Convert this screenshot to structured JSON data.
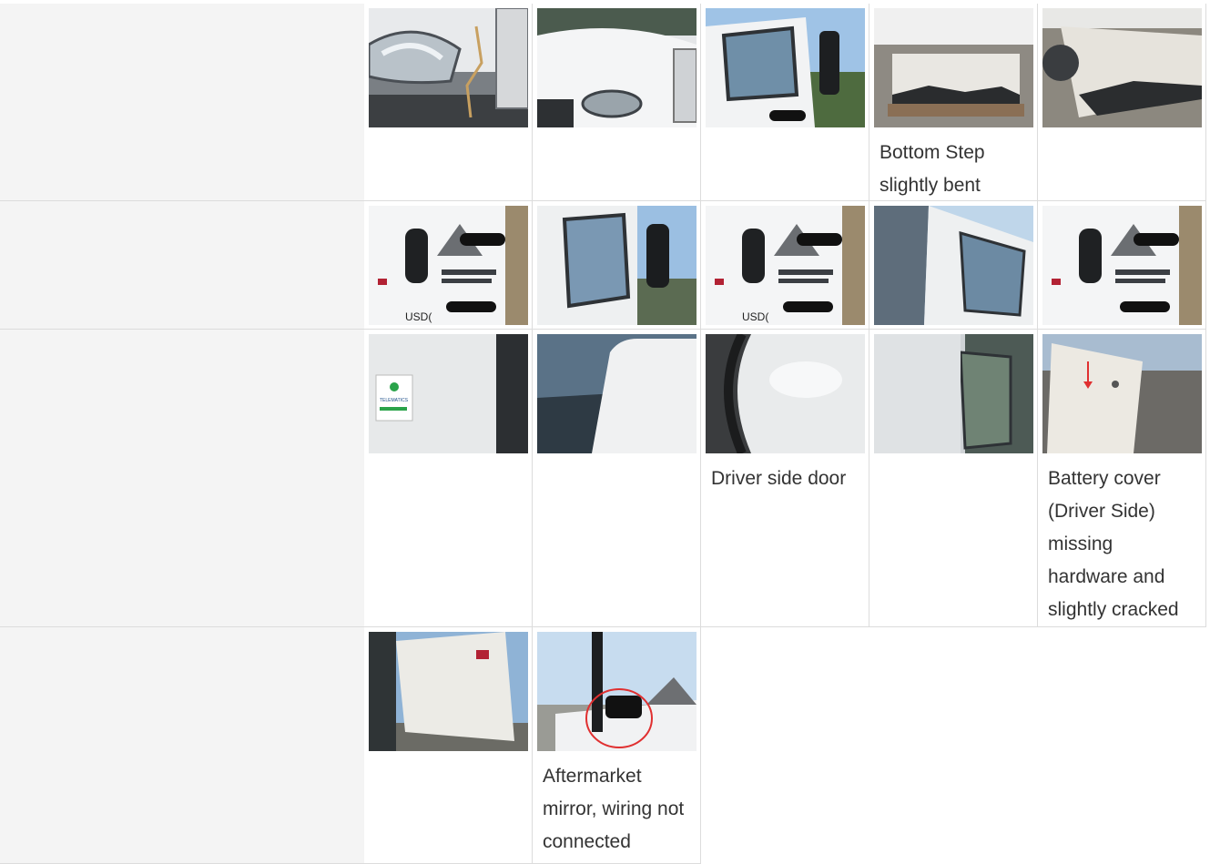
{
  "rows": [
    {
      "photos": [
        {
          "icon": "headlight-crack-photo",
          "caption": "",
          "scene": "headlight"
        },
        {
          "icon": "front-hood-photo",
          "caption": "",
          "scene": "hood"
        },
        {
          "icon": "cab-window-photo",
          "caption": "",
          "scene": "cabwindow"
        },
        {
          "icon": "bottom-step-photo",
          "caption": "Bottom Step slightly bent",
          "scene": "step"
        },
        {
          "icon": "step-closeup-photo",
          "caption": "",
          "scene": "step2"
        }
      ]
    },
    {
      "photos": [
        {
          "icon": "door-logo-photo",
          "caption": "",
          "scene": "door",
          "door_text": "USD("
        },
        {
          "icon": "mirror-window-photo",
          "caption": "",
          "scene": "mirror"
        },
        {
          "icon": "door-flag-photo",
          "caption": "",
          "scene": "door2",
          "door_text": "USD("
        },
        {
          "icon": "cab-side-photo",
          "caption": "",
          "scene": "cabside"
        },
        {
          "icon": "door-handle-photo",
          "caption": "",
          "scene": "door3"
        }
      ]
    },
    {
      "photos": [
        {
          "icon": "telematics-sticker-photo",
          "caption": "",
          "scene": "telematics",
          "sticker_text": "TELEMATICS"
        },
        {
          "icon": "cab-corner-photo",
          "caption": "",
          "scene": "corner"
        },
        {
          "icon": "driver-door-photo",
          "caption": "Driver side door",
          "scene": "seal"
        },
        {
          "icon": "panel-reflection-photo",
          "caption": "",
          "scene": "panel"
        },
        {
          "icon": "battery-cover-photo",
          "caption": "Battery cover (Driver Side) missing hardware and slightly cracked",
          "scene": "battery"
        }
      ]
    },
    {
      "photos": [
        {
          "icon": "rear-cab-photo",
          "caption": "",
          "scene": "rearcab"
        },
        {
          "icon": "aftermarket-mirror-photo",
          "caption": "Aftermarket mirror, wiring not connected",
          "scene": "mirror2"
        }
      ]
    }
  ],
  "colors": {
    "label_bg": "#f4f4f4",
    "border": "#dcdcdc",
    "text": "#333333",
    "accent_red": "#e03030"
  }
}
